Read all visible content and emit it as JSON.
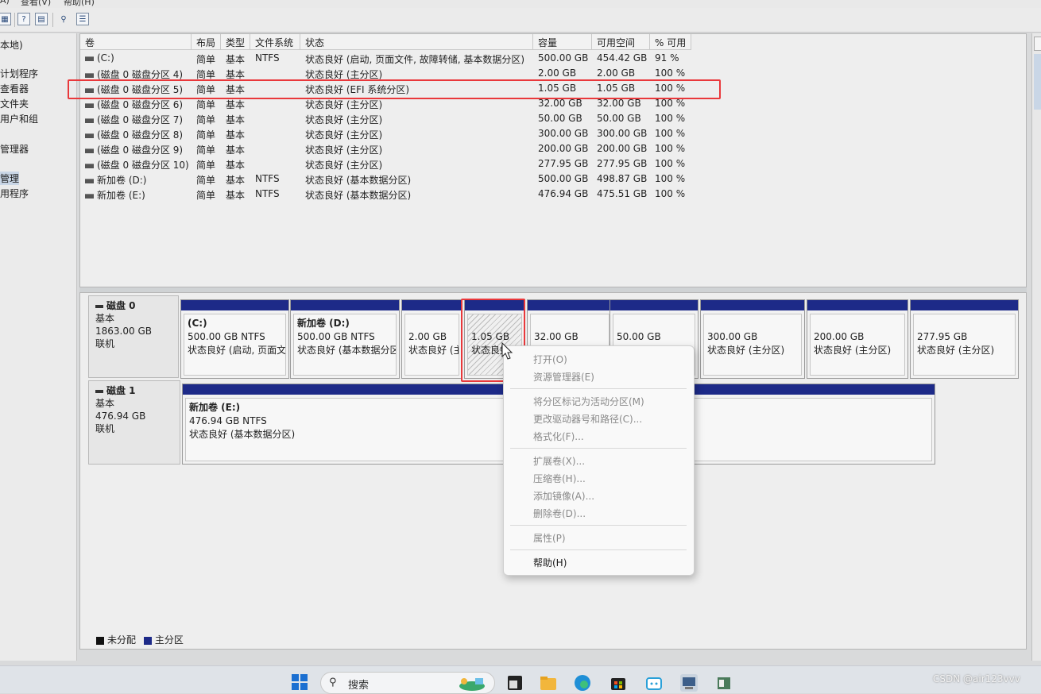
{
  "menu": [
    "A)",
    "查看(V)",
    "帮助(H)"
  ],
  "tree": {
    "items": [
      {
        "label": "本地)",
        "selected": false
      },
      {
        "label": "计划程序",
        "selected": false
      },
      {
        "label": "查看器",
        "selected": false
      },
      {
        "label": "文件夹",
        "selected": false
      },
      {
        "label": "用户和组",
        "selected": false
      },
      {
        "label": "管理器",
        "selected": false
      },
      {
        "label": "管理",
        "selected": true
      },
      {
        "label": "用程序",
        "selected": false
      }
    ]
  },
  "volume_list": {
    "headers": [
      "卷",
      "布局",
      "类型",
      "文件系统",
      "状态",
      "容量",
      "可用空间",
      "% 可用"
    ],
    "rows": [
      [
        "(C:)",
        "简单",
        "基本",
        "NTFS",
        "状态良好 (启动, 页面文件, 故障转储, 基本数据分区)",
        "500.00 GB",
        "454.42 GB",
        "91 %"
      ],
      [
        "(磁盘 0 磁盘分区 4)",
        "简单",
        "基本",
        "",
        "状态良好 (主分区)",
        "2.00 GB",
        "2.00 GB",
        "100 %"
      ],
      [
        "(磁盘 0 磁盘分区 5)",
        "简单",
        "基本",
        "",
        "状态良好 (EFI 系统分区)",
        "1.05 GB",
        "1.05 GB",
        "100 %"
      ],
      [
        "(磁盘 0 磁盘分区 6)",
        "简单",
        "基本",
        "",
        "状态良好 (主分区)",
        "32.00 GB",
        "32.00 GB",
        "100 %"
      ],
      [
        "(磁盘 0 磁盘分区 7)",
        "简单",
        "基本",
        "",
        "状态良好 (主分区)",
        "50.00 GB",
        "50.00 GB",
        "100 %"
      ],
      [
        "(磁盘 0 磁盘分区 8)",
        "简单",
        "基本",
        "",
        "状态良好 (主分区)",
        "300.00 GB",
        "300.00 GB",
        "100 %"
      ],
      [
        "(磁盘 0 磁盘分区 9)",
        "简单",
        "基本",
        "",
        "状态良好 (主分区)",
        "200.00 GB",
        "200.00 GB",
        "100 %"
      ],
      [
        "(磁盘 0 磁盘分区 10)",
        "简单",
        "基本",
        "",
        "状态良好 (主分区)",
        "277.95 GB",
        "277.95 GB",
        "100 %"
      ],
      [
        "新加卷 (D:)",
        "简单",
        "基本",
        "NTFS",
        "状态良好 (基本数据分区)",
        "500.00 GB",
        "498.87 GB",
        "100 %"
      ],
      [
        "新加卷 (E:)",
        "简单",
        "基本",
        "NTFS",
        "状态良好 (基本数据分区)",
        "476.94 GB",
        "475.51 GB",
        "100 %"
      ]
    ],
    "highlighted_row": 2
  },
  "disks": [
    {
      "name": "磁盘 0",
      "type": "基本",
      "size": "1863.00 GB",
      "status": "联机",
      "partitions": [
        {
          "l1": "(C:)",
          "l2": "500.00 GB NTFS",
          "l3": "状态良好 (启动, 页面文",
          "bold": true,
          "hatch": false
        },
        {
          "l1": "新加卷  (D:)",
          "l2": "500.00 GB NTFS",
          "l3": "状态良好 (基本数据分区",
          "bold": true,
          "hatch": false
        },
        {
          "l1": "",
          "l2": "2.00 GB",
          "l3": "状态良好 (主",
          "bold": false,
          "hatch": false
        },
        {
          "l1": "",
          "l2": "1.05 GB",
          "l3": "状态良好",
          "bold": false,
          "hatch": true
        },
        {
          "l1": "",
          "l2": "32.00 GB",
          "l3": "",
          "bold": false,
          "hatch": false
        },
        {
          "l1": "",
          "l2": "50.00 GB",
          "l3": "",
          "bold": false,
          "hatch": false
        },
        {
          "l1": "",
          "l2": "300.00 GB",
          "l3": "状态良好 (主分区)",
          "bold": false,
          "hatch": false
        },
        {
          "l1": "",
          "l2": "200.00 GB",
          "l3": "状态良好 (主分区)",
          "bold": false,
          "hatch": false
        },
        {
          "l1": "",
          "l2": "277.95 GB",
          "l3": "状态良好 (主分区)",
          "bold": false,
          "hatch": false
        }
      ]
    },
    {
      "name": "磁盘 1",
      "type": "基本",
      "size": "476.94 GB",
      "status": "联机",
      "partitions": [
        {
          "l1": "新加卷  (E:)",
          "l2": "476.94 GB NTFS",
          "l3": "状态良好 (基本数据分区)",
          "bold": true,
          "hatch": false
        }
      ]
    }
  ],
  "legend": [
    {
      "label": "未分配",
      "color": "#111111"
    },
    {
      "label": "主分区",
      "color": "#1d2a88"
    }
  ],
  "context_menu": {
    "items": [
      {
        "label": "打开(O)",
        "enabled": false
      },
      {
        "label": "资源管理器(E)",
        "enabled": false
      },
      {
        "sep": true
      },
      {
        "label": "将分区标记为活动分区(M)",
        "enabled": false
      },
      {
        "label": "更改驱动器号和路径(C)...",
        "enabled": false
      },
      {
        "label": "格式化(F)...",
        "enabled": false
      },
      {
        "sep": true
      },
      {
        "label": "扩展卷(X)...",
        "enabled": false
      },
      {
        "label": "压缩卷(H)...",
        "enabled": false
      },
      {
        "label": "添加镜像(A)...",
        "enabled": false
      },
      {
        "label": "删除卷(D)...",
        "enabled": false
      },
      {
        "sep": true
      },
      {
        "label": "属性(P)",
        "enabled": false
      },
      {
        "sep": true
      },
      {
        "label": "帮助(H)",
        "enabled": true
      }
    ]
  },
  "taskbar": {
    "search_placeholder": "搜索",
    "search_icon": "magnifier-icon",
    "app_icons": [
      "windows-start-icon",
      "weather-widget-icon",
      "terminal-icon",
      "file-explorer-icon",
      "edge-browser-icon",
      "store-icon",
      "bilibili-icon",
      "disk-management-icon",
      "app-icon"
    ]
  },
  "watermark": "CSDN @air123vvv",
  "colors": {
    "primary_partition": "#1d2a88",
    "highlight_box": "#e9383b"
  }
}
